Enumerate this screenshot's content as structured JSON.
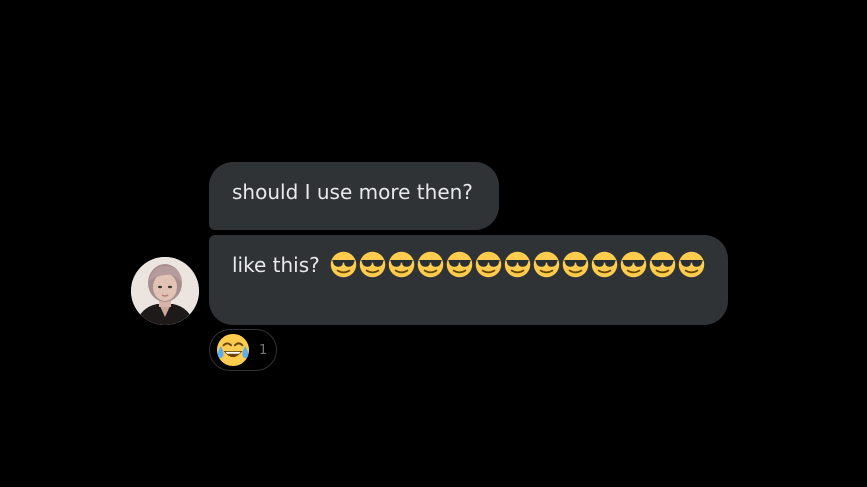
{
  "messages": [
    {
      "text": "should I use more then?",
      "emoji": null,
      "emoji_count": 0
    },
    {
      "text": "like this?",
      "emoji": "smiling-face-with-sunglasses",
      "emoji_count": 13
    }
  ],
  "sender": {
    "avatar_icon": "user-avatar-photo"
  },
  "reaction": {
    "emoji": "face-with-tears-of-joy",
    "count": "1"
  },
  "colors": {
    "background": "#000000",
    "bubble": "#2f3336",
    "text": "#e7e9ea",
    "muted_text": "#71767b",
    "emoji_yellow": "#ffcc4d"
  }
}
